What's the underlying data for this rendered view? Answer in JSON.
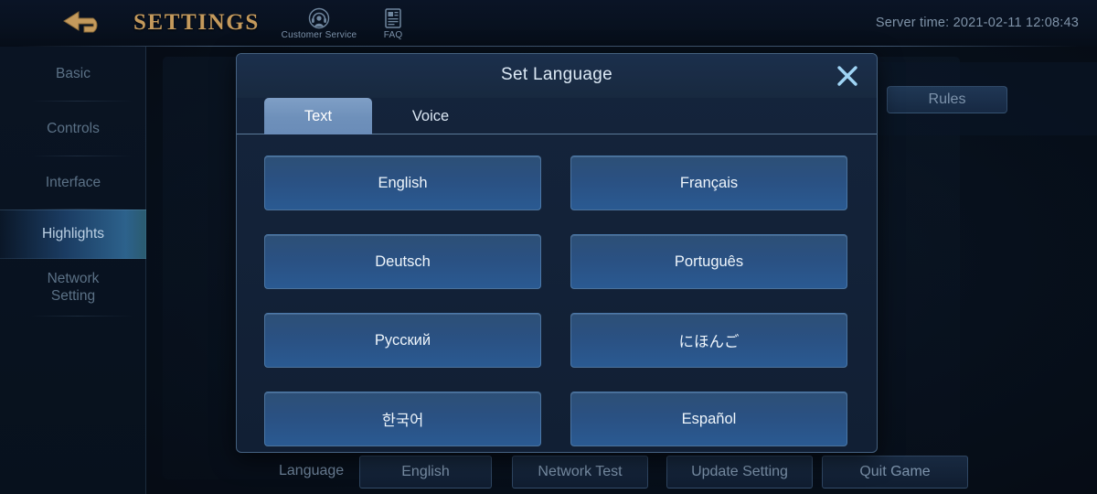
{
  "topbar": {
    "back_icon": "back-arrow-icon",
    "title": "SETTINGS",
    "customer_service": {
      "icon": "headset-icon",
      "label": "Customer Service"
    },
    "faq": {
      "icon": "document-icon",
      "label": "FAQ"
    },
    "server_time": "Server time: 2021-02-11 12:08:43"
  },
  "sidebar": {
    "items": [
      {
        "label": "Basic",
        "active": false
      },
      {
        "label": "Controls",
        "active": false
      },
      {
        "label": "Interface",
        "active": false
      },
      {
        "label": "Highlights",
        "active": true
      },
      {
        "label": "Network Setting",
        "active": false
      }
    ]
  },
  "background": {
    "rules_button": "Rules"
  },
  "modal": {
    "title": "Set Language",
    "close_icon": "close-icon",
    "tabs": [
      {
        "label": "Text",
        "active": true
      },
      {
        "label": "Voice",
        "active": false
      }
    ],
    "languages": [
      "English",
      "Français",
      "Deutsch",
      "Português",
      "Русский",
      "にほんご",
      "한국어",
      "Español"
    ]
  },
  "bottombar": {
    "language_label": "Language",
    "language_value": "English",
    "network_test": "Network Test",
    "update_setting": "Update Setting",
    "quit_game": "Quit Game"
  },
  "colors": {
    "accent_gold": "#c49a5c",
    "accent_blue": "#6e90ba",
    "lang_button": "#2a5183",
    "close_x": "#9fd4f5"
  }
}
